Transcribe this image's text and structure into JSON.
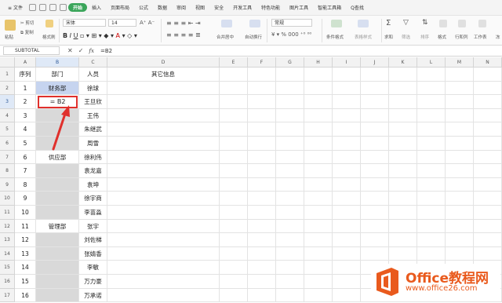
{
  "menubar": {
    "file": "文件",
    "tabs": [
      "开始",
      "插入",
      "页面布局",
      "公式",
      "数据",
      "审阅",
      "视图",
      "安全",
      "开发工具",
      "特色功能",
      "图片工具",
      "智能工具箱"
    ],
    "active_tab": "开始",
    "search": "Q查找"
  },
  "ribbon": {
    "cut": "剪切",
    "copy": "复制",
    "paste": "粘贴",
    "format_painter": "格式刷",
    "font_name": "宋体",
    "font_size": "14",
    "merge_center": "合并居中",
    "wrap": "自动换行",
    "number_format": "常规",
    "cond_format": "条件格式",
    "table_style": "表格样式",
    "sum": "求和",
    "filter": "筛选",
    "sort": "排序",
    "format": "格式",
    "row_col": "行和列",
    "worksheet": "工作表",
    "freeze": "冻"
  },
  "formula_bar": {
    "name_box": "SUBTOTAL",
    "cancel": "✕",
    "accept": "✓",
    "fx": "fx",
    "value": "=B2"
  },
  "columns": [
    "A",
    "B",
    "C",
    "D",
    "E",
    "F",
    "G",
    "H",
    "I",
    "J",
    "K",
    "L",
    "M",
    "N"
  ],
  "rows": [
    {
      "n": "1",
      "a": "序列",
      "b": "部门",
      "c": "人员",
      "d": "其它信息"
    },
    {
      "n": "2",
      "a": "1",
      "b": "财务部",
      "c": "徐球",
      "d": ""
    },
    {
      "n": "3",
      "a": "2",
      "b": "= B2",
      "c": "王旦欣",
      "d": ""
    },
    {
      "n": "4",
      "a": "3",
      "b": "",
      "c": "王伟",
      "d": ""
    },
    {
      "n": "5",
      "a": "4",
      "b": "",
      "c": "朱继武",
      "d": ""
    },
    {
      "n": "6",
      "a": "5",
      "b": "",
      "c": "周雪",
      "d": ""
    },
    {
      "n": "7",
      "a": "6",
      "b": "供应部",
      "c": "徐利伟",
      "d": ""
    },
    {
      "n": "8",
      "a": "7",
      "b": "",
      "c": "袁龙嘉",
      "d": ""
    },
    {
      "n": "9",
      "a": "8",
      "b": "",
      "c": "袁坤",
      "d": ""
    },
    {
      "n": "10",
      "a": "9",
      "b": "",
      "c": "徐宇商",
      "d": ""
    },
    {
      "n": "11",
      "a": "10",
      "b": "",
      "c": "李苗淼",
      "d": ""
    },
    {
      "n": "12",
      "a": "11",
      "b": "管理部",
      "c": "张宇",
      "d": ""
    },
    {
      "n": "13",
      "a": "12",
      "b": "",
      "c": "刘佐梯",
      "d": ""
    },
    {
      "n": "14",
      "a": "13",
      "b": "",
      "c": "张婧香",
      "d": ""
    },
    {
      "n": "15",
      "a": "14",
      "b": "",
      "c": "李敏",
      "d": ""
    },
    {
      "n": "16",
      "a": "15",
      "b": "",
      "c": "万力豪",
      "d": ""
    },
    {
      "n": "17",
      "a": "16",
      "b": "",
      "c": "万承诺",
      "d": ""
    }
  ],
  "logo": {
    "line1a": "Office",
    "line1b": "教程网",
    "line2": "www.office26.com"
  },
  "colors": {
    "accent": "#3aa55a",
    "highlight_box": "#e0302c",
    "selected_cell": "#c6d4ef",
    "blank_dept": "#d9d9d9",
    "logo": "#e95a1d"
  }
}
